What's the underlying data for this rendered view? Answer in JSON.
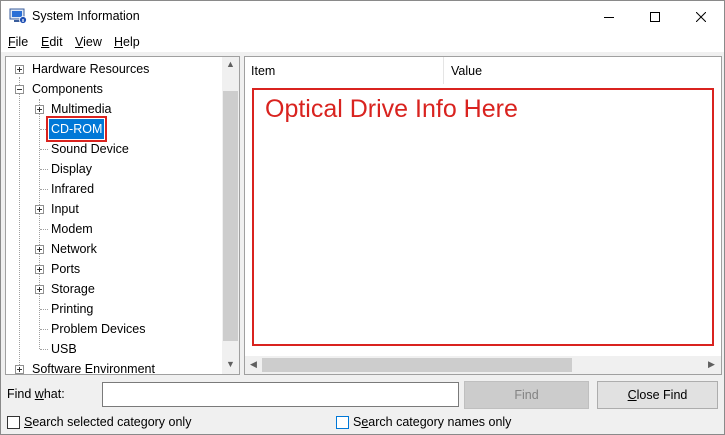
{
  "window": {
    "title": "System Information",
    "icon": "system-info-icon"
  },
  "menu": [
    {
      "access_key": "F",
      "rest": "ile"
    },
    {
      "access_key": "E",
      "rest": "dit"
    },
    {
      "access_key": "V",
      "rest": "iew"
    },
    {
      "access_key": "H",
      "rest": "elp"
    }
  ],
  "tree": {
    "hardware_resources": "Hardware Resources",
    "components": "Components",
    "multimedia": "Multimedia",
    "cdrom": "CD-ROM",
    "sound_device": "Sound Device",
    "display": "Display",
    "infrared": "Infrared",
    "input": "Input",
    "modem": "Modem",
    "network": "Network",
    "ports": "Ports",
    "storage": "Storage",
    "printing": "Printing",
    "problem_devices": "Problem Devices",
    "usb": "USB",
    "software_environment": "Software Environment"
  },
  "list": {
    "col_item": "Item",
    "col_value": "Value",
    "annotation": "Optical Drive Info Here"
  },
  "find": {
    "label_pre": "Find ",
    "label_key": "w",
    "label_post": "hat:",
    "value": "",
    "find_button": "Find",
    "close_find_key": "C",
    "close_find_rest": "lose Find"
  },
  "options": {
    "selected_only_key": "S",
    "selected_only_rest": "earch selected category only",
    "names_only_pre": "S",
    "names_only_key": "e",
    "names_only_rest": "arch category names only"
  },
  "colors": {
    "selection": "#0078d7",
    "annotation_red": "#d9231f"
  }
}
